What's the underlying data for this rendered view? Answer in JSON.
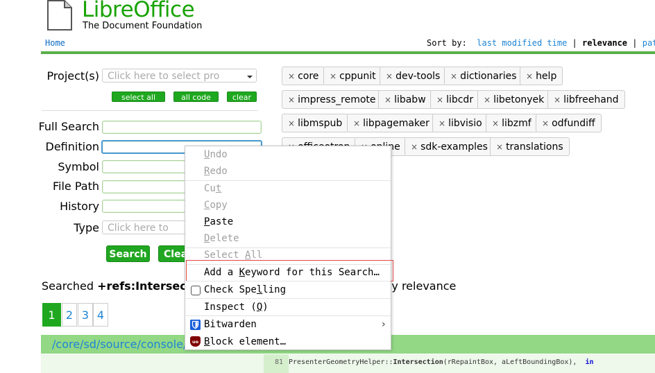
{
  "header": {
    "brand_libre": "Libre",
    "brand_office": "Office",
    "brand_sub": "The Document Foundation",
    "home": "Home",
    "sort_label": "Sort by:",
    "sort_last_modified": "last modified time",
    "sort_sep1": "|",
    "sort_relevance": "relevance",
    "sort_sep2": "|",
    "sort_path": "pat"
  },
  "form": {
    "project_label": "Project(s)",
    "project_placeholder": "Click here to select pro",
    "select_all": "select all",
    "all_code": "all code",
    "clear": "clear",
    "full_search_label": "Full Search",
    "definition_label": "Definition",
    "symbol_label": "Symbol",
    "file_path_label": "File Path",
    "history_label": "History",
    "type_label": "Type",
    "type_placeholder": "Click here to",
    "search_button": "Search",
    "clear_button": "Clea"
  },
  "projects": {
    "remove_glyph": "×",
    "tags": [
      "core",
      "cppunit",
      "dev-tools",
      "dictionaries",
      "help",
      "impress_remote",
      "libabw",
      "libcdr",
      "libetonyek",
      "libfreehand",
      "libmspub",
      "libpagemaker",
      "libvisio",
      "libzmf",
      "odfundiff",
      "officeotron",
      "online",
      "sdk-examples",
      "translations"
    ]
  },
  "results": {
    "searched_prefix": "Searched ",
    "searched_query": "+refs:Intersectio",
    "searched_suffix": "d by relevance",
    "pages": [
      "1",
      "2",
      "3",
      "4"
    ],
    "active_page": "1",
    "result_path": "/core/sd/source/console/",
    "code_line_no": "81",
    "code_prefix": "PresenterGeometryHelper::",
    "code_bold": "Intersection",
    "code_rest": "(rRepaintBox, aLeftBoundingBox),",
    "code_kw": "in"
  },
  "context_menu": {
    "undo_pre": "",
    "undo_u": "U",
    "undo_post": "ndo",
    "redo_pre": "",
    "redo_u": "R",
    "redo_post": "edo",
    "cut_pre": "Cu",
    "cut_u": "t",
    "cut_post": "",
    "copy_pre": "",
    "copy_u": "C",
    "copy_post": "opy",
    "paste_pre": "",
    "paste_u": "P",
    "paste_post": "aste",
    "delete_pre": "",
    "delete_u": "D",
    "delete_post": "elete",
    "selectall_pre": "Select ",
    "selectall_u": "A",
    "selectall_post": "ll",
    "keyword_pre": "Add a ",
    "keyword_u": "K",
    "keyword_post": "eyword for this Search…",
    "spell_pre": "Check Spe",
    "spell_u": "l",
    "spell_post": "ling",
    "inspect_pre": "Inspect (",
    "inspect_u": "Q",
    "inspect_post": ")",
    "bitwarden": "Bitwarden",
    "submenu_arrow": "›",
    "block_pre": "",
    "block_u": "B",
    "block_post": "lock element…",
    "icons": {
      "bitwarden": "bitwarden-shield-icon",
      "ublock": "ublock-origin-icon"
    }
  }
}
